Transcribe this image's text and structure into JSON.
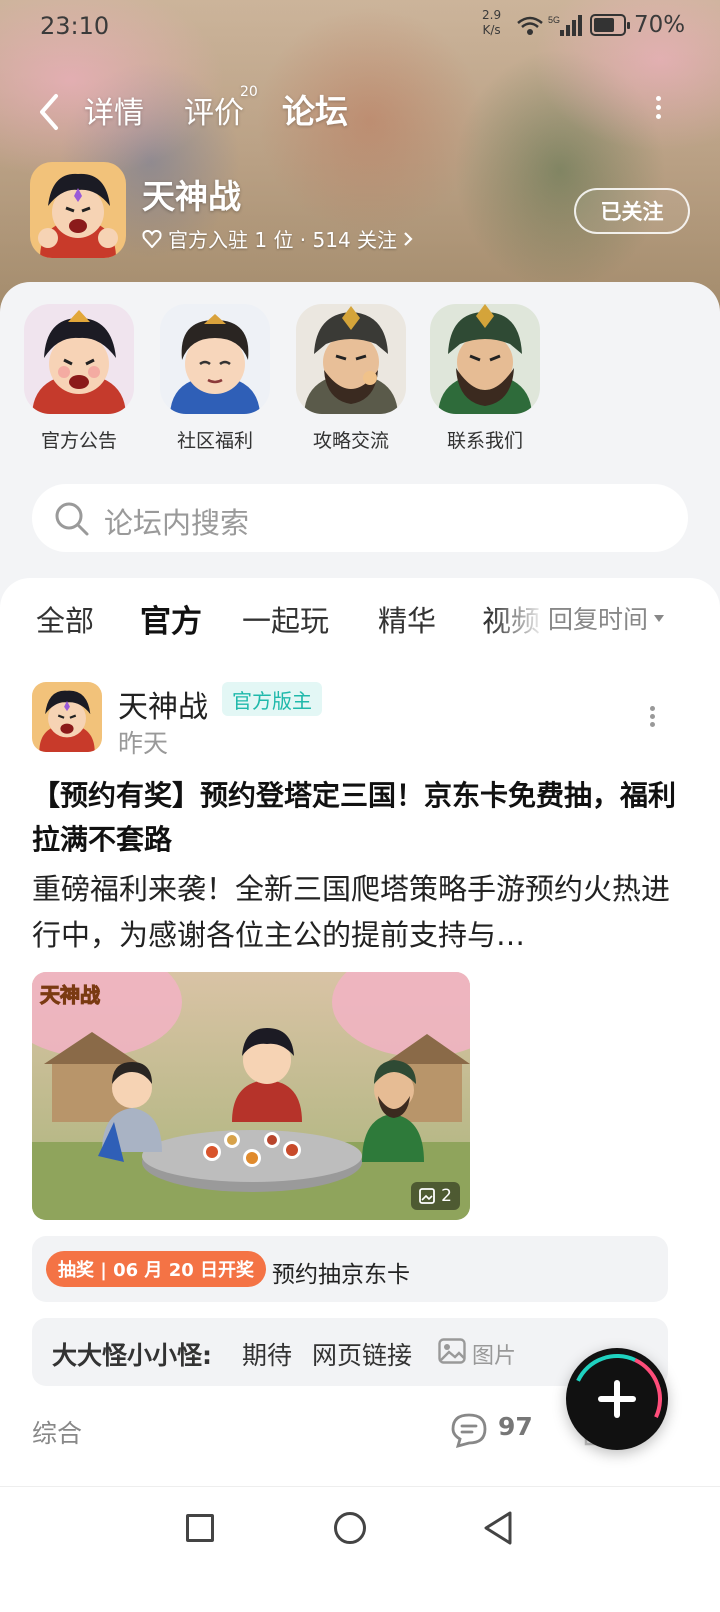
{
  "status_bar": {
    "time": "23:10",
    "net_speed_value": "2.9",
    "net_speed_unit": "K/s",
    "network": "5G",
    "battery": "70%"
  },
  "top_nav": {
    "tabs": [
      {
        "label": "详情"
      },
      {
        "label": "评价",
        "badge": "20"
      },
      {
        "label": "论坛",
        "active": true
      }
    ]
  },
  "game": {
    "name": "天神战",
    "meta": "官方入驻 1 位 · 514 关注",
    "follow_label": "已关注"
  },
  "categories": [
    {
      "label": "官方公告"
    },
    {
      "label": "社区福利"
    },
    {
      "label": "攻略交流"
    },
    {
      "label": "联系我们"
    }
  ],
  "search": {
    "placeholder": "论坛内搜索"
  },
  "feed_tabs": [
    {
      "label": "全部"
    },
    {
      "label": "官方",
      "active": true
    },
    {
      "label": "一起玩"
    },
    {
      "label": "精华"
    },
    {
      "label": "视频"
    }
  ],
  "sort": {
    "label": "回复时间"
  },
  "post": {
    "author": "天神战",
    "badge": "官方版主",
    "time": "昨天",
    "title": "【预约有奖】预约登塔定三国！京东卡免费抽，福利拉满不套路",
    "body": "重磅福利来袭！全新三国爬塔策略手游预约火热进行中，为感谢各位主公的提前支持与…",
    "image_logo": "天神战",
    "image_count": "2",
    "lottery_tag": "抽奖 | 06 月 20 日开奖",
    "lottery_text": "预约抽京东卡",
    "comment_user": "大大怪小小怪:",
    "comment_text": "期待",
    "comment_link": "网页链接",
    "comment_pic": "图片",
    "category": "综合",
    "comment_count": "97"
  },
  "colors": {
    "accent": "#21d3c3",
    "lottery": "#f47345"
  }
}
